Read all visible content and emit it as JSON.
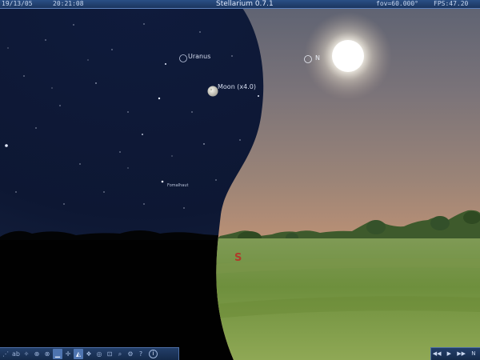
{
  "status_bar": {
    "date": "19/13/05",
    "time": "20:21:08",
    "app_title": "Stellarium 0.7.1",
    "fov": "fov=60.000°",
    "fps": "FPS:47.20"
  },
  "sky_labels": {
    "uranus": "Uranus",
    "moon": "Moon (x4.0)",
    "fomalhaut": "Fomalhaut",
    "north_marker": "N",
    "cardinal_south": "S"
  },
  "toolbar": {
    "buttons": [
      {
        "icon": "constellation-lines-icon",
        "glyph": "⋰"
      },
      {
        "icon": "constellation-names-icon",
        "glyph": "ab"
      },
      {
        "icon": "constellation-art-icon",
        "glyph": "✧"
      },
      {
        "icon": "azimuthal-grid-icon",
        "glyph": "⊕"
      },
      {
        "icon": "equatorial-grid-icon",
        "glyph": "⊗"
      },
      {
        "icon": "ground-icon",
        "glyph": "▁"
      },
      {
        "icon": "cardinal-points-icon",
        "glyph": "✛"
      },
      {
        "icon": "atmosphere-icon",
        "glyph": "◭"
      },
      {
        "icon": "nebula-names-icon",
        "glyph": "❖"
      },
      {
        "icon": "track-object-icon",
        "glyph": "◎"
      },
      {
        "icon": "zoom-icon",
        "glyph": "⊡"
      },
      {
        "icon": "search-icon",
        "glyph": "⌕"
      },
      {
        "icon": "configuration-icon",
        "glyph": "⚙"
      },
      {
        "icon": "help-icon",
        "glyph": "?"
      }
    ],
    "active_indices": [
      5,
      7
    ],
    "info_glyph": "i"
  },
  "time_controls": {
    "rewind": "◀◀",
    "play": "▶",
    "fast_forward": "▶▶",
    "now": "N"
  },
  "colors": {
    "night_sky": "#0a1430",
    "day_sky_top": "#6f6a73",
    "day_horizon": "#d59a72",
    "grass": "#7a9a4a",
    "cardinal_red": "#b03a2a",
    "bar_blue": "#1b355e"
  }
}
